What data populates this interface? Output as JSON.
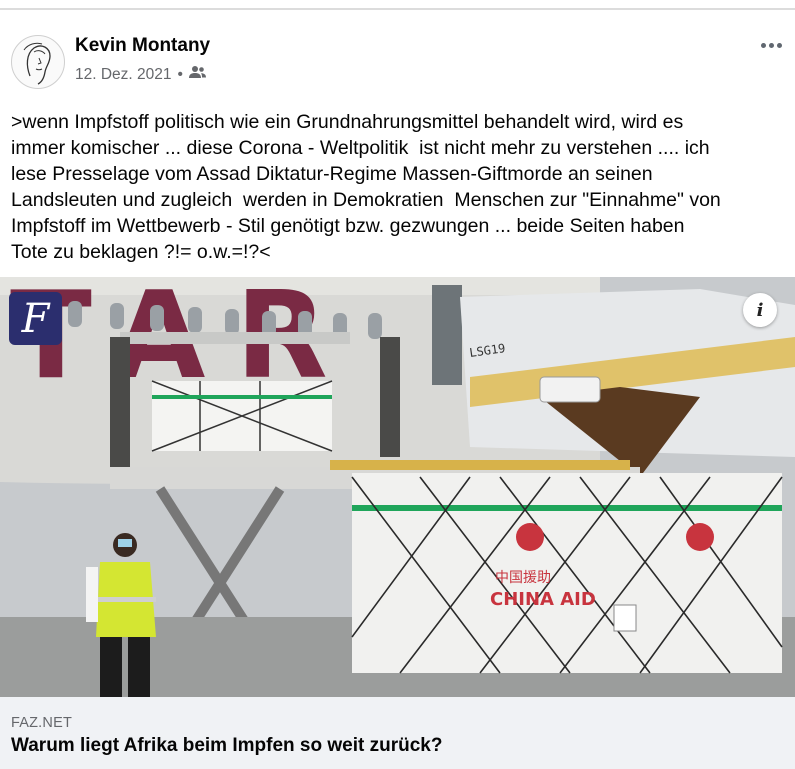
{
  "post": {
    "author": "Kevin Montany",
    "date": "12. Dez. 2021",
    "separator": "•",
    "privacy_icon": "friends-icon",
    "more_icon": "more-options-icon",
    "text": ">wenn Impfstoff politisch wie ein Grundnahrungsmittel behandelt wird, wird es\nimmer komischer ... diese Corona - Weltpolitik  ist nicht mehr zu verstehen .... ich\nlese Presselage vom Assad Diktatur-Regime Massen-Giftmorde an seinen\nLandsleuten und zugleich  werden in Demokratien  Menschen zur \"Einnahme\" von\nImpfstoff im Wettbewerb - Stil genötigt bzw. gezwungen ... beide Seiten haben\nTote zu beklagen ?!= o.w.=!?<"
  },
  "image": {
    "publisher_badge": "F",
    "info_label": "i",
    "plane_letters": "TAR",
    "loader_code": "LSG19",
    "crate_text": "CHINA AID",
    "crate_cn": "中国援助"
  },
  "link": {
    "domain": "FAZ.NET",
    "title": "Warum liegt Afrika beim Impfen so weit zurück?"
  },
  "colors": {
    "text_primary": "#050505",
    "text_secondary": "#65676b",
    "card_background": "#f0f2f5",
    "plane_livery": "#7a2a44",
    "faz_blue": "#2b2e6e"
  }
}
